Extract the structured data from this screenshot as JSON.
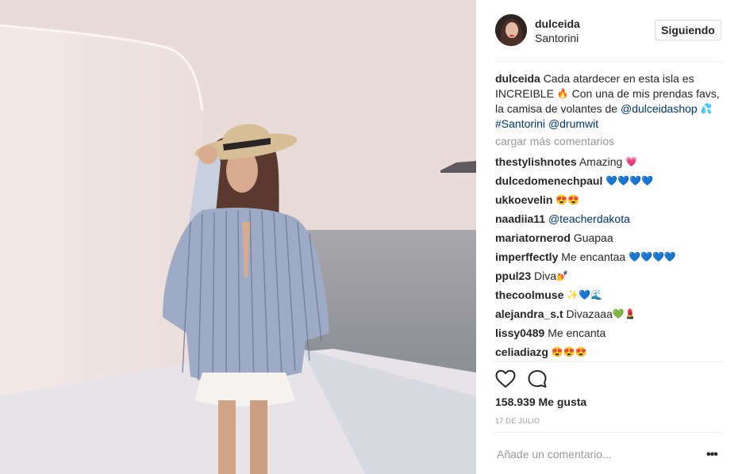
{
  "header": {
    "username": "dulceida",
    "location": "Santorini",
    "follow_label": "Siguiendo"
  },
  "caption": {
    "username": "dulceida",
    "text1": "Cada atardecer en esta isla es INCREIBLE",
    "emoji1": "🔥",
    "text2": " Con una de mis prendas favs, la camisa de volantes de ",
    "mention1": "@dulceidashop",
    "emoji2": "💦",
    "hashtag": "#Santorini",
    "mention2": "@drumwit"
  },
  "load_more": "cargar más comentarios",
  "comments": [
    {
      "user": "thestylishnotes",
      "text": "Amazing ",
      "link": "",
      "emoji": "💗"
    },
    {
      "user": "dulcedomenechpaul",
      "text": "",
      "link": "",
      "emoji": "💙💙💙💙"
    },
    {
      "user": "ukkoevelin",
      "text": "",
      "link": "",
      "emoji": "😍😍"
    },
    {
      "user": "naadiia11",
      "text": "",
      "link": "@teacherdakota",
      "emoji": ""
    },
    {
      "user": "mariatornerod",
      "text": "Guapaa",
      "link": "",
      "emoji": ""
    },
    {
      "user": "imperffectly",
      "text": "Me encantaa ",
      "link": "",
      "emoji": "💙💙💙💙"
    },
    {
      "user": "ppul23",
      "text": "Diva",
      "link": "",
      "emoji": "💅"
    },
    {
      "user": "thecoolmuse",
      "text": "",
      "link": "",
      "emoji": "✨💙🌊"
    },
    {
      "user": "alejandra_s.t",
      "text": "Divazaaa",
      "link": "",
      "emoji": "💚💄"
    },
    {
      "user": "lissy0489",
      "text": "Me encanta",
      "link": "",
      "emoji": ""
    },
    {
      "user": "celiadiazg",
      "text": "",
      "link": "",
      "emoji": "😍😍😍"
    }
  ],
  "likes": "158.939 Me gusta",
  "date": "17 DE JULIO",
  "comment_input": {
    "placeholder": "Añade un comentario..."
  },
  "more_options": "•••",
  "icons": {
    "like": "heart-icon",
    "comment": "comment-icon",
    "options": "more-options-icon"
  },
  "colors": {
    "link": "#003569",
    "muted": "#999999",
    "border": "#dbdbdb"
  }
}
